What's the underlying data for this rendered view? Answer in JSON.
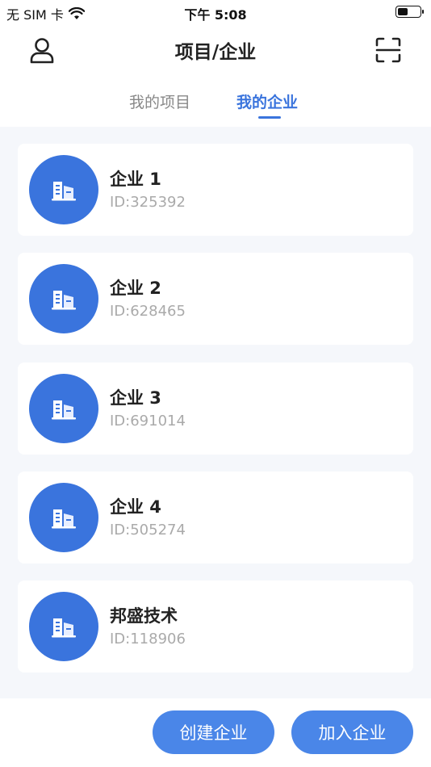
{
  "status_bar": {
    "carrier": "无 SIM 卡",
    "time": "下午 5:08",
    "battery_level": 0.45
  },
  "nav": {
    "title": "项目/企业",
    "user_icon": "user-icon",
    "scan_icon": "scan-icon"
  },
  "tabs": [
    {
      "label": "我的项目",
      "active": false
    },
    {
      "label": "我的企业",
      "active": true
    }
  ],
  "enterprises": [
    {
      "name": "企业 1",
      "id": "ID:325392"
    },
    {
      "name": "企业 2",
      "id": "ID:628465"
    },
    {
      "name": "企业 3",
      "id": "ID:691014"
    },
    {
      "name": "企业 4",
      "id": "ID:505274"
    },
    {
      "name": "邦盛技术",
      "id": "ID:118906"
    }
  ],
  "actions": {
    "create_label": "创建企业",
    "join_label": "加入企业"
  },
  "colors": {
    "accent": "#3a74dd",
    "button": "#4a86e8",
    "background": "#f5f7fb"
  }
}
